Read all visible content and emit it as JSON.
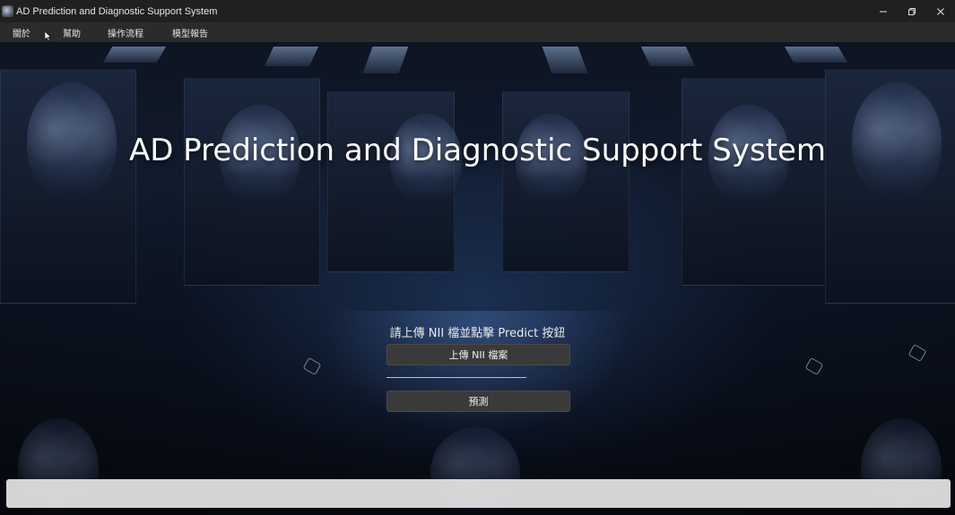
{
  "window": {
    "title": "AD Prediction and Diagnostic Support System",
    "controls": {
      "minimize_icon": "minimize-icon",
      "maximize_icon": "restore-icon",
      "close_icon": "close-icon"
    }
  },
  "menu": {
    "items": [
      {
        "label": "關於"
      },
      {
        "label": "幫助"
      },
      {
        "label": "操作流程"
      },
      {
        "label": "模型報告"
      }
    ]
  },
  "main": {
    "title": "AD Prediction and Diagnostic Support System",
    "instruction": "請上傳 NII 檔並點擊 Predict 按鈕",
    "upload_button": "上傳 NII 檔案",
    "predict_button": "預測",
    "selected_file": ""
  },
  "status_bar": {
    "text": ""
  },
  "colors": {
    "titlebar_bg": "#202020",
    "menubar_bg": "#2b2b2b",
    "button_bg": "#3a3a3a",
    "title_text": "#ffffff"
  }
}
